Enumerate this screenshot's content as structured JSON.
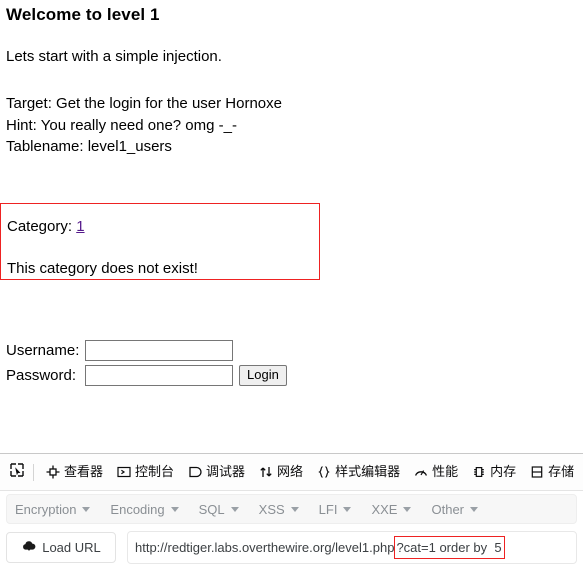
{
  "page": {
    "title": "Welcome to level 1",
    "intro": "Lets start with a simple injection.",
    "target": "Target: Get the login for the user Hornoxe",
    "hint": "Hint: You really need one? omg -_-",
    "tablename": "Tablename: level1_users",
    "result_box": {
      "category_label": "Category:",
      "category_value": "1",
      "message": "This category does not exist!",
      "border_color": "#ee2222",
      "link_color": "#551a8b"
    },
    "form": {
      "username_label": "Username:",
      "username_value": "",
      "password_label": "Password:",
      "password_value": "",
      "login_button": "Login"
    }
  },
  "devtools": {
    "picker_icon": "element-picker-icon",
    "tabs": [
      {
        "label": "查看器",
        "icon": "inspector-icon"
      },
      {
        "label": "控制台",
        "icon": "console-icon"
      },
      {
        "label": "调试器",
        "icon": "debugger-icon"
      },
      {
        "label": "网络",
        "icon": "network-icon"
      },
      {
        "label": "样式编辑器",
        "icon": "style-editor-icon"
      },
      {
        "label": "性能",
        "icon": "performance-icon"
      },
      {
        "label": "内存",
        "icon": "memory-icon"
      },
      {
        "label": "存储",
        "icon": "storage-icon"
      }
    ]
  },
  "hackbar": {
    "menus": [
      {
        "label": "Encryption"
      },
      {
        "label": "Encoding"
      },
      {
        "label": "SQL"
      },
      {
        "label": "XSS"
      },
      {
        "label": "LFI"
      },
      {
        "label": "XXE"
      },
      {
        "label": "Other"
      }
    ],
    "load_url_button": "Load URL",
    "load_url_icon": "cloud-download-icon",
    "url_prefix": "http://redtiger.labs.overthewire.org/level1.php",
    "url_selection": "?cat=1 order by  5",
    "selection_border_color": "#ee2222"
  }
}
